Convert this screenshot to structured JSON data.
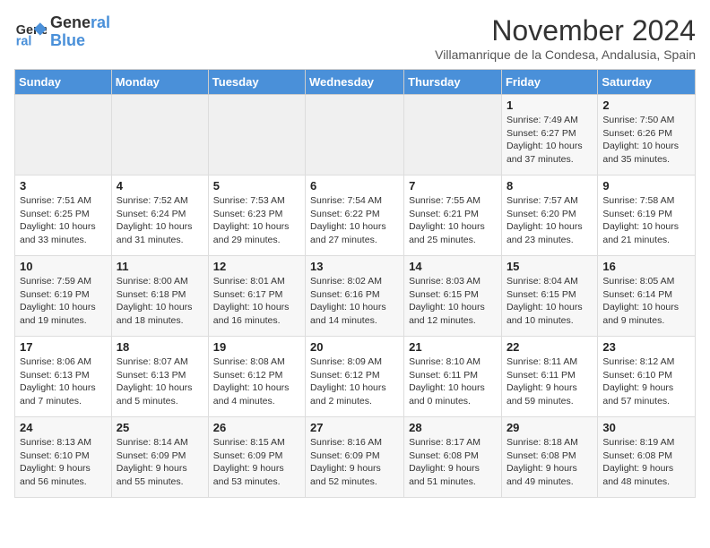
{
  "logo": {
    "line1": "General",
    "line2": "Blue"
  },
  "title": "November 2024",
  "subtitle": "Villamanrique de la Condesa, Andalusia, Spain",
  "headers": [
    "Sunday",
    "Monday",
    "Tuesday",
    "Wednesday",
    "Thursday",
    "Friday",
    "Saturday"
  ],
  "weeks": [
    [
      {
        "day": "",
        "info": ""
      },
      {
        "day": "",
        "info": ""
      },
      {
        "day": "",
        "info": ""
      },
      {
        "day": "",
        "info": ""
      },
      {
        "day": "",
        "info": ""
      },
      {
        "day": "1",
        "info": "Sunrise: 7:49 AM\nSunset: 6:27 PM\nDaylight: 10 hours and 37 minutes."
      },
      {
        "day": "2",
        "info": "Sunrise: 7:50 AM\nSunset: 6:26 PM\nDaylight: 10 hours and 35 minutes."
      }
    ],
    [
      {
        "day": "3",
        "info": "Sunrise: 7:51 AM\nSunset: 6:25 PM\nDaylight: 10 hours and 33 minutes."
      },
      {
        "day": "4",
        "info": "Sunrise: 7:52 AM\nSunset: 6:24 PM\nDaylight: 10 hours and 31 minutes."
      },
      {
        "day": "5",
        "info": "Sunrise: 7:53 AM\nSunset: 6:23 PM\nDaylight: 10 hours and 29 minutes."
      },
      {
        "day": "6",
        "info": "Sunrise: 7:54 AM\nSunset: 6:22 PM\nDaylight: 10 hours and 27 minutes."
      },
      {
        "day": "7",
        "info": "Sunrise: 7:55 AM\nSunset: 6:21 PM\nDaylight: 10 hours and 25 minutes."
      },
      {
        "day": "8",
        "info": "Sunrise: 7:57 AM\nSunset: 6:20 PM\nDaylight: 10 hours and 23 minutes."
      },
      {
        "day": "9",
        "info": "Sunrise: 7:58 AM\nSunset: 6:19 PM\nDaylight: 10 hours and 21 minutes."
      }
    ],
    [
      {
        "day": "10",
        "info": "Sunrise: 7:59 AM\nSunset: 6:19 PM\nDaylight: 10 hours and 19 minutes."
      },
      {
        "day": "11",
        "info": "Sunrise: 8:00 AM\nSunset: 6:18 PM\nDaylight: 10 hours and 18 minutes."
      },
      {
        "day": "12",
        "info": "Sunrise: 8:01 AM\nSunset: 6:17 PM\nDaylight: 10 hours and 16 minutes."
      },
      {
        "day": "13",
        "info": "Sunrise: 8:02 AM\nSunset: 6:16 PM\nDaylight: 10 hours and 14 minutes."
      },
      {
        "day": "14",
        "info": "Sunrise: 8:03 AM\nSunset: 6:15 PM\nDaylight: 10 hours and 12 minutes."
      },
      {
        "day": "15",
        "info": "Sunrise: 8:04 AM\nSunset: 6:15 PM\nDaylight: 10 hours and 10 minutes."
      },
      {
        "day": "16",
        "info": "Sunrise: 8:05 AM\nSunset: 6:14 PM\nDaylight: 10 hours and 9 minutes."
      }
    ],
    [
      {
        "day": "17",
        "info": "Sunrise: 8:06 AM\nSunset: 6:13 PM\nDaylight: 10 hours and 7 minutes."
      },
      {
        "day": "18",
        "info": "Sunrise: 8:07 AM\nSunset: 6:13 PM\nDaylight: 10 hours and 5 minutes."
      },
      {
        "day": "19",
        "info": "Sunrise: 8:08 AM\nSunset: 6:12 PM\nDaylight: 10 hours and 4 minutes."
      },
      {
        "day": "20",
        "info": "Sunrise: 8:09 AM\nSunset: 6:12 PM\nDaylight: 10 hours and 2 minutes."
      },
      {
        "day": "21",
        "info": "Sunrise: 8:10 AM\nSunset: 6:11 PM\nDaylight: 10 hours and 0 minutes."
      },
      {
        "day": "22",
        "info": "Sunrise: 8:11 AM\nSunset: 6:11 PM\nDaylight: 9 hours and 59 minutes."
      },
      {
        "day": "23",
        "info": "Sunrise: 8:12 AM\nSunset: 6:10 PM\nDaylight: 9 hours and 57 minutes."
      }
    ],
    [
      {
        "day": "24",
        "info": "Sunrise: 8:13 AM\nSunset: 6:10 PM\nDaylight: 9 hours and 56 minutes."
      },
      {
        "day": "25",
        "info": "Sunrise: 8:14 AM\nSunset: 6:09 PM\nDaylight: 9 hours and 55 minutes."
      },
      {
        "day": "26",
        "info": "Sunrise: 8:15 AM\nSunset: 6:09 PM\nDaylight: 9 hours and 53 minutes."
      },
      {
        "day": "27",
        "info": "Sunrise: 8:16 AM\nSunset: 6:09 PM\nDaylight: 9 hours and 52 minutes."
      },
      {
        "day": "28",
        "info": "Sunrise: 8:17 AM\nSunset: 6:08 PM\nDaylight: 9 hours and 51 minutes."
      },
      {
        "day": "29",
        "info": "Sunrise: 8:18 AM\nSunset: 6:08 PM\nDaylight: 9 hours and 49 minutes."
      },
      {
        "day": "30",
        "info": "Sunrise: 8:19 AM\nSunset: 6:08 PM\nDaylight: 9 hours and 48 minutes."
      }
    ]
  ]
}
